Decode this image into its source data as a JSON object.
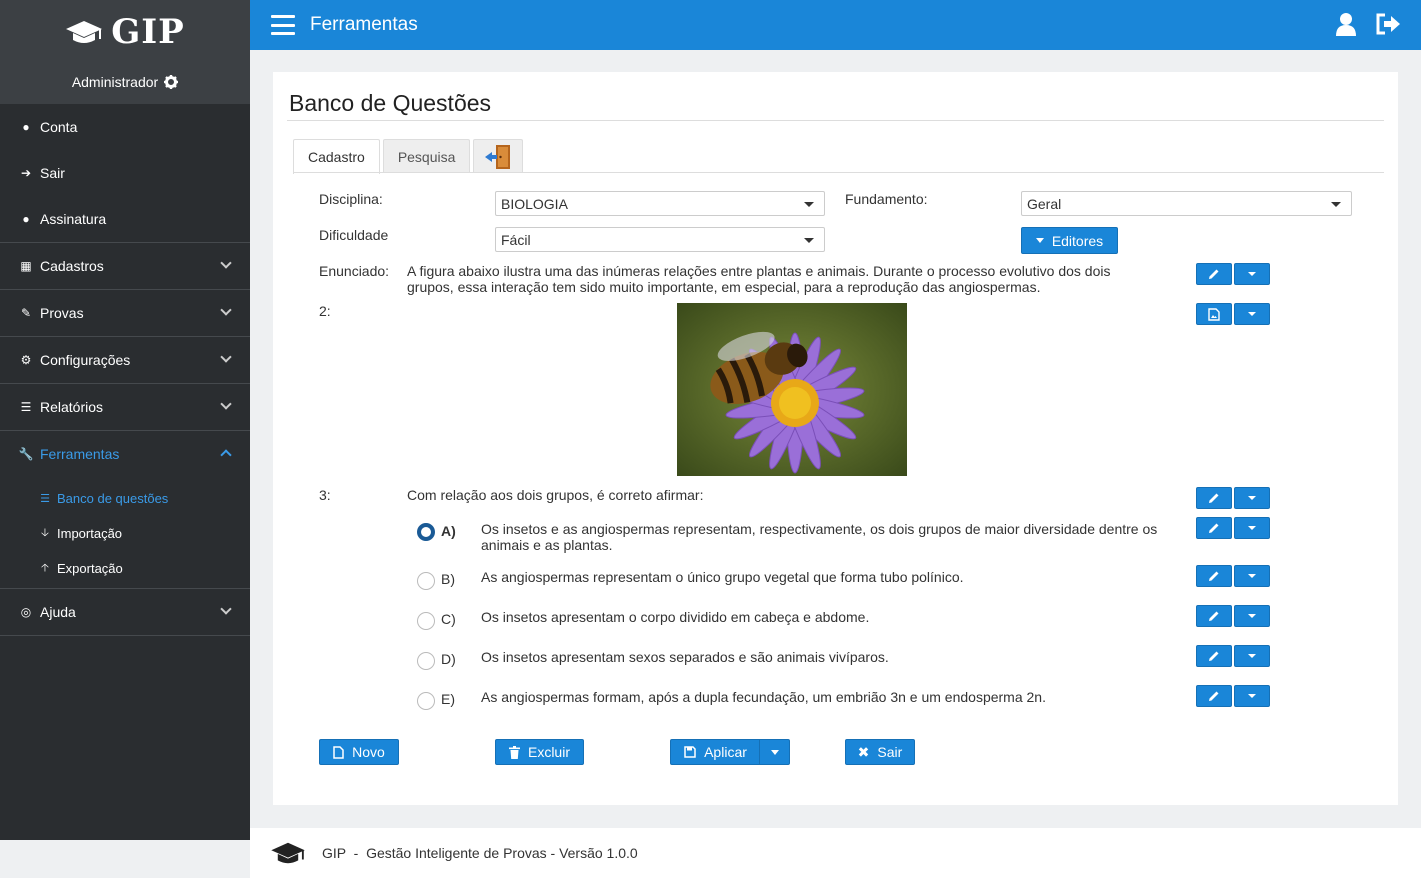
{
  "sidebar": {
    "brand": "GIP",
    "user": "Administrador",
    "items": [
      {
        "label": "Conta",
        "icon": "user-icon"
      },
      {
        "label": "Sair",
        "icon": "sign-out-icon"
      },
      {
        "label": "Assinatura",
        "icon": "user-icon"
      },
      {
        "label": "Cadastros",
        "icon": "sitemap-icon"
      },
      {
        "label": "Provas",
        "icon": "edit-icon"
      },
      {
        "label": "Configurações",
        "icon": "cogs-icon"
      },
      {
        "label": "Relatórios",
        "icon": "list-icon"
      },
      {
        "label": "Ferramentas",
        "icon": "wrench-icon"
      },
      {
        "label": "Ajuda",
        "icon": "life-ring-icon"
      }
    ],
    "subitems": [
      {
        "label": "Banco de questões",
        "icon": "database-icon"
      },
      {
        "label": "Importação",
        "icon": "arrow-down-icon"
      },
      {
        "label": "Exportação",
        "icon": "arrow-up-icon"
      }
    ]
  },
  "topbar": {
    "title": "Ferramentas"
  },
  "page": {
    "title": "Banco de Questões",
    "tabs": [
      "Cadastro",
      "Pesquisa"
    ],
    "form": {
      "disciplina_label": "Disciplina:",
      "disciplina_value": "BIOLOGIA",
      "fundamento_label": "Fundamento:",
      "fundamento_value": "Geral",
      "dificuldade_label": "Dificuldade",
      "dificuldade_value": "Fácil",
      "editores_label": "Editores"
    },
    "enunciado_label": "Enunciado:",
    "enunciado_text": "A figura abaixo ilustra uma das inúmeras relações entre plantas e animais. Durante o processo evolutivo dos dois grupos, essa interação tem sido muito importante, em especial, para a reprodução das angiospermas.",
    "item2_label": "2:",
    "item3_label": "3:",
    "item3_text": "Com relação aos dois grupos, é correto afirmar:",
    "options": [
      {
        "letter": "A)",
        "text": "Os insetos e as angiospermas representam, respectivamente, os dois grupos de maior diversidade dentre os animais e as plantas."
      },
      {
        "letter": "B)",
        "text": "As angiospermas representam o único grupo vegetal que forma tubo polínico."
      },
      {
        "letter": "C)",
        "text": "Os insetos apresentam o corpo dividido em cabeça e abdome."
      },
      {
        "letter": "D)",
        "text": "Os insetos apresentam sexos separados e são animais vivíparos."
      },
      {
        "letter": "E)",
        "text": "As angiospermas formam, após a dupla fecundação, um embrião 3n e um endosperma 2n."
      }
    ],
    "selected_option": "A)",
    "buttons": {
      "novo": "Novo",
      "excluir": "Excluir",
      "aplicar": "Aplicar",
      "sair": "Sair"
    }
  },
  "footer": {
    "text": "GIP  -  Gestão Inteligente de Provas - Versão 1.0.0"
  },
  "colors": {
    "primary": "#1a86d8",
    "sidebar": "#2a2d30",
    "active": "#3a9be8"
  }
}
